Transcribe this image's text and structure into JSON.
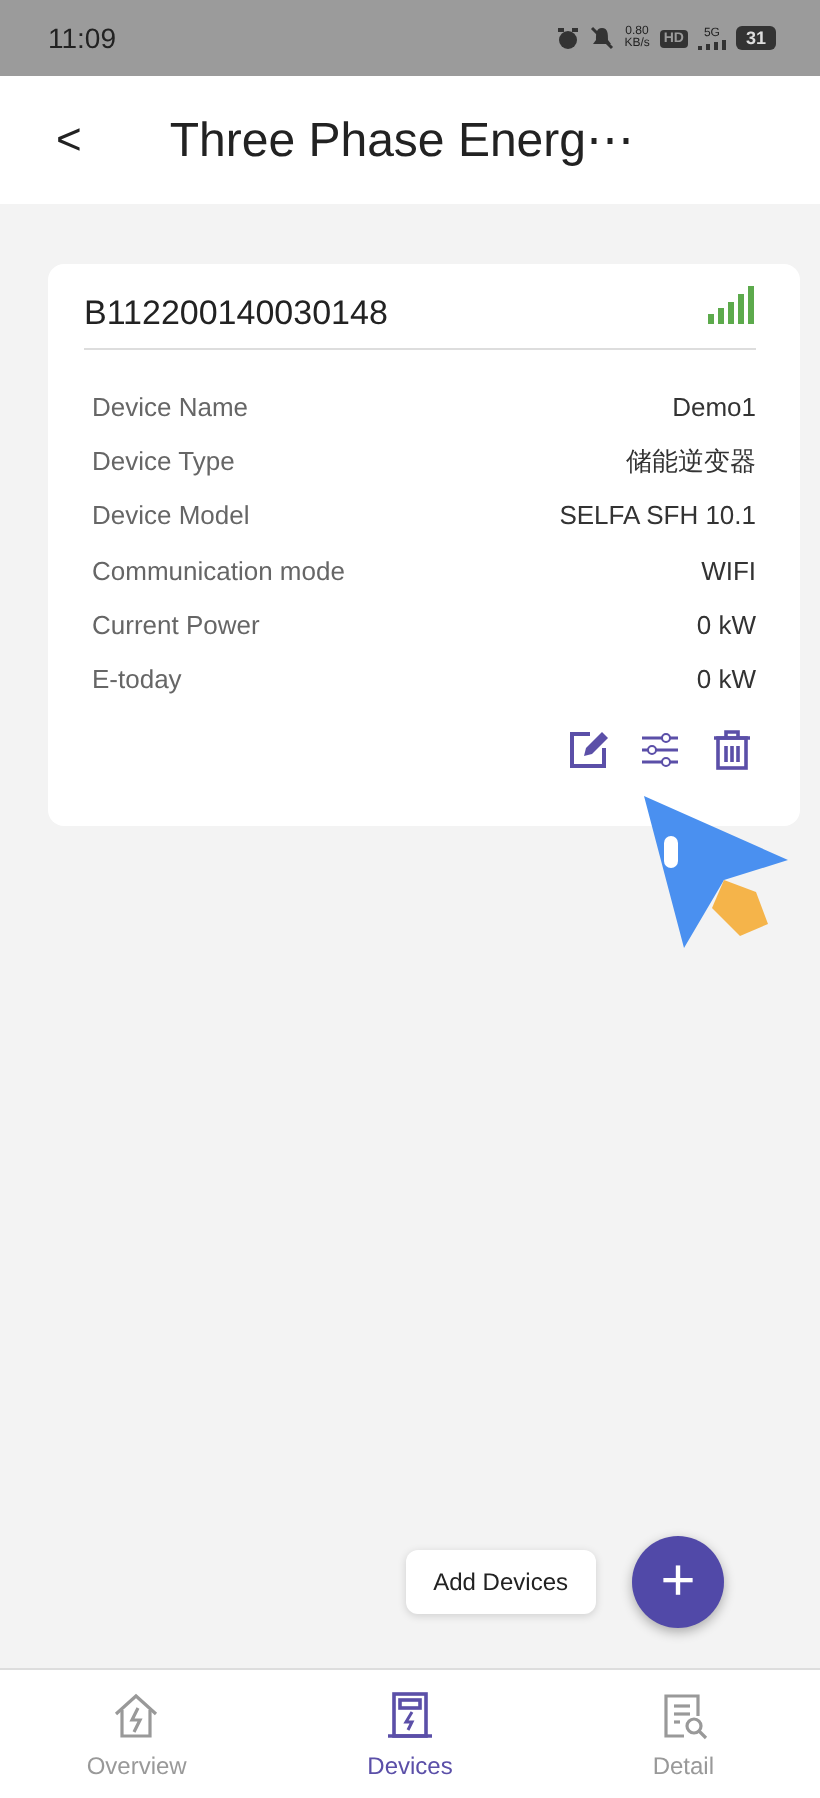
{
  "status_bar": {
    "time": "11:09",
    "net_speed": "0.80",
    "net_unit": "KB/s",
    "hd": "HD",
    "network": "5G",
    "battery": "31"
  },
  "header": {
    "back": "<",
    "title": "Three Phase Energ⋯"
  },
  "device": {
    "serial": "B112200140030148",
    "fields": [
      {
        "label": "Device Name",
        "value": "Demo1"
      },
      {
        "label": "Device Type",
        "value": "储能逆变器"
      },
      {
        "label": "Device Model",
        "value": "SELFA SFH 10.1"
      },
      {
        "label": "Communication mode",
        "value": "WIFI"
      },
      {
        "label": "Current Power",
        "value": "0 kW"
      },
      {
        "label": "E-today",
        "value": "0 kW"
      }
    ]
  },
  "add_button": {
    "label": "Add Devices",
    "icon": "+"
  },
  "tabs": [
    {
      "label": "Overview",
      "selected": false,
      "kind": "home"
    },
    {
      "label": "Devices",
      "selected": true,
      "kind": "device"
    },
    {
      "label": "Detail",
      "selected": false,
      "kind": "detail"
    }
  ]
}
